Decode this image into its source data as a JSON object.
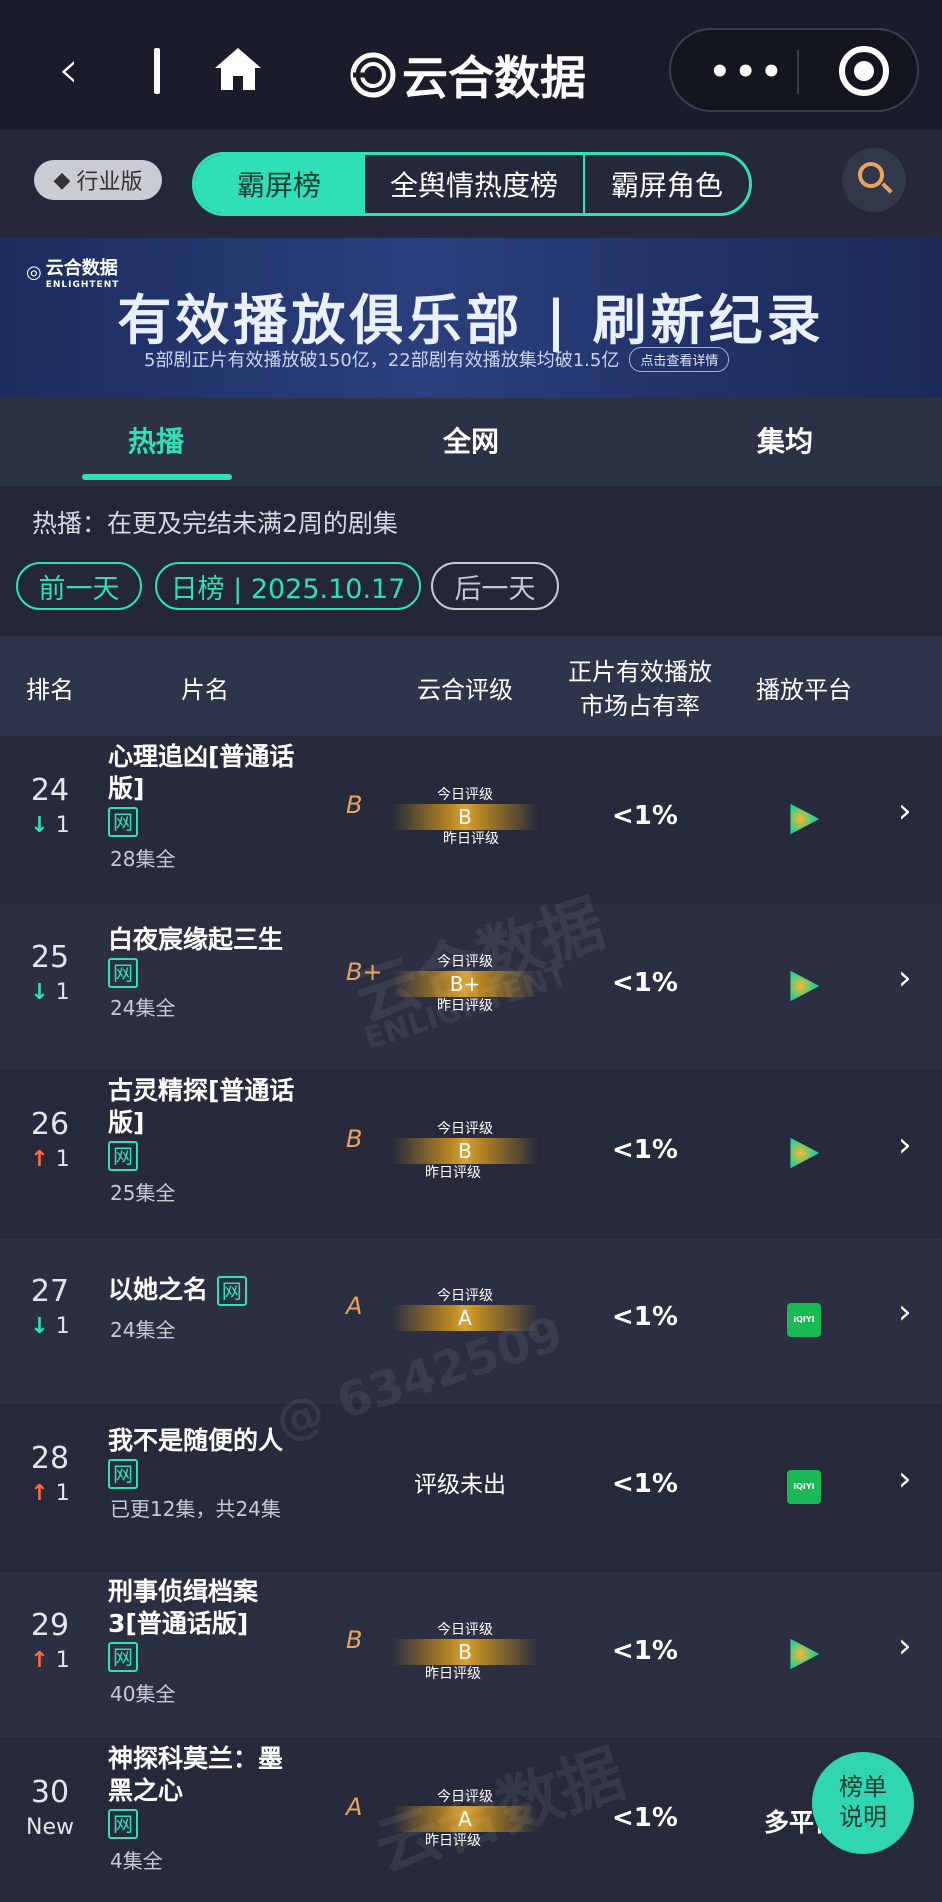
{
  "topbar": {
    "back": "‹",
    "brand": "云合数据",
    "more": "•••"
  },
  "header": {
    "industry_label": "行业版",
    "tabs": [
      "霸屏榜",
      "全舆情热度榜",
      "霸屏角色"
    ]
  },
  "banner": {
    "logo": "云合数据",
    "logo_en": "ENLIGHTENT",
    "headline": "有效播放俱乐部 | 刷新纪录",
    "subline": "5部剧正片有效播放破150亿，22部剧有效播放集均破1.5亿",
    "detail_btn": "点击查看详情"
  },
  "subtabs": [
    "热播",
    "全网",
    "集均"
  ],
  "note": "热播：在更及完结未满2周的剧集",
  "date": {
    "prev": "前一天",
    "current": "日榜 | 2025.10.17",
    "next": "后一天"
  },
  "table_header": {
    "rank": "排名",
    "title": "片名",
    "rating": "云合评级",
    "share_l1": "正片有效播放",
    "share_l2": "市场占有率",
    "platform": "播放平台"
  },
  "meter_labels": {
    "today": "今日评级",
    "yesterday": "昨日评级"
  },
  "rows": [
    {
      "rank": "24",
      "arrow": "↓",
      "dir": "down",
      "change": "1",
      "title_l1": "心理追凶[普通话",
      "title_l2": "版]",
      "tag": "网",
      "eps": "28集全",
      "grade": "B",
      "meter": "B",
      "share": "<1%",
      "platform": "tencent-video"
    },
    {
      "rank": "25",
      "arrow": "↓",
      "dir": "down",
      "change": "1",
      "title_l1": "白夜宸缘起三生",
      "title_l2": "",
      "tag": "网",
      "eps": "24集全",
      "grade": "B+",
      "meter": "B+",
      "share": "<1%",
      "platform": "tencent-video"
    },
    {
      "rank": "26",
      "arrow": "↑",
      "dir": "up",
      "change": "1",
      "title_l1": "古灵精探[普通话",
      "title_l2": "版]",
      "tag": "网",
      "eps": "25集全",
      "grade": "B",
      "meter": "B",
      "share": "<1%",
      "platform": "tencent-video"
    },
    {
      "rank": "27",
      "arrow": "↓",
      "dir": "down",
      "change": "1",
      "title_l1": "以她之名",
      "title_l2": "",
      "tag": "网",
      "eps": "24集全",
      "grade": "A",
      "meter": "A",
      "share": "<1%",
      "platform": "iqiyi"
    },
    {
      "rank": "28",
      "arrow": "↑",
      "dir": "up",
      "change": "1",
      "title_l1": "我不是随便的人",
      "title_l2": "",
      "tag": "网",
      "eps": "已更12集，共24集",
      "unrated": "评级未出",
      "share": "<1%",
      "platform": "iqiyi"
    },
    {
      "rank": "29",
      "arrow": "↑",
      "dir": "up",
      "change": "1",
      "title_l1": "刑事侦缉档案",
      "title_l2": "3[普通话版]",
      "tag": "网",
      "eps": "40集全",
      "grade": "B",
      "meter": "B",
      "share": "<1%",
      "platform": "tencent-video"
    },
    {
      "rank": "30",
      "change_text": "New",
      "title_l1": "神探科莫兰：墨",
      "title_l2": "黑之心",
      "tag": "网",
      "eps": "4集全",
      "grade": "A",
      "meter": "A",
      "share": "<1%",
      "platform_text": "多平台"
    }
  ],
  "platform_icons": {
    "iqiyi": "iQIYI"
  },
  "float_btn": {
    "l1": "榜单",
    "l2": "说明"
  },
  "watermarks": [
    "云合数据",
    "ENLIGHTENT",
    "@ 6342509"
  ],
  "colors": {
    "accent": "#2fe0b6",
    "up": "#ff6b3d",
    "grade": "#e8a45c",
    "bg": "#232738"
  }
}
